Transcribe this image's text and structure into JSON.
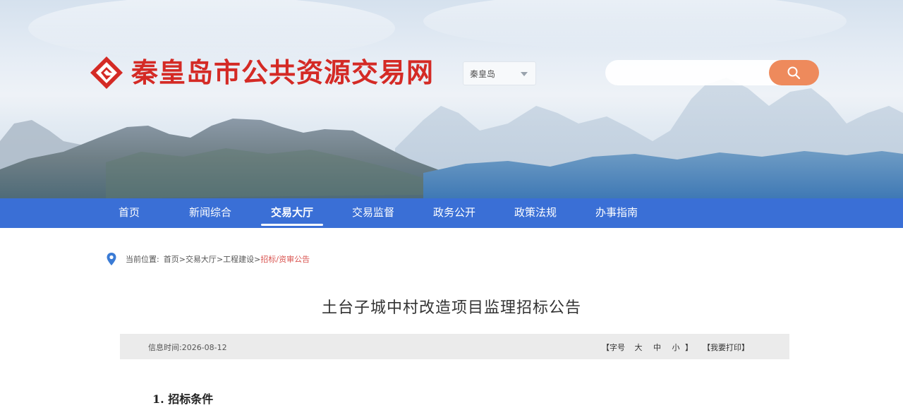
{
  "header": {
    "site_title": "秦皇岛市公共资源交易网",
    "region_select": {
      "value": "秦皇岛"
    },
    "search": {
      "placeholder": ""
    },
    "icons": {
      "logo": "diamond-emblem-icon",
      "search": "search-icon",
      "dropdown": "chevron-down-icon"
    }
  },
  "nav": {
    "items": [
      {
        "label": "首页",
        "active": false
      },
      {
        "label": "新闻综合",
        "active": false
      },
      {
        "label": "交易大厅",
        "active": true
      },
      {
        "label": "交易监督",
        "active": false
      },
      {
        "label": "政务公开",
        "active": false
      },
      {
        "label": "政策法规",
        "active": false
      },
      {
        "label": "办事指南",
        "active": false
      }
    ],
    "color": "#3a6fd6"
  },
  "breadcrumb": {
    "prefix": "当前位置:",
    "items": [
      "首页",
      "交易大厅",
      "工程建设"
    ],
    "current": "招标/资审公告",
    "separator": ">",
    "icon": "location-pin-icon"
  },
  "article": {
    "title": "土台子城中村改造项目监理招标公告",
    "info": {
      "date_label": "信息时间:2026-08-12",
      "font_size_open": "【字号",
      "font_sizes": [
        "大",
        "中",
        "小"
      ],
      "font_size_close": "】",
      "print": "【我要打印】"
    },
    "section_1": "1.  招标条件"
  },
  "colors": {
    "brand_red": "#d42a25",
    "nav_blue": "#3a6fd6",
    "search_orange": "#ee8a5c",
    "breadcrumb_current": "#d9534f"
  }
}
